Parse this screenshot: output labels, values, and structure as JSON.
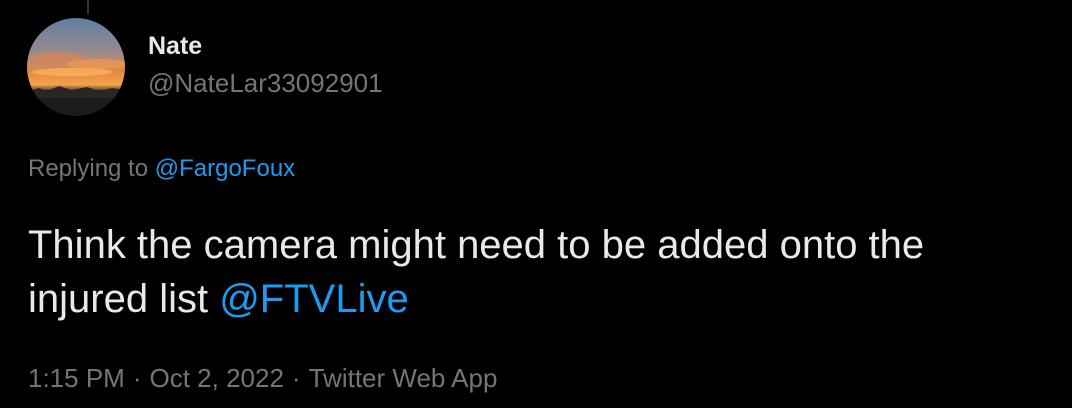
{
  "tweet": {
    "author": {
      "display_name": "Nate",
      "handle": "@NateLar33092901"
    },
    "replying_prefix": "Replying to",
    "replying_to": "@FargoFoux",
    "text_line1": "Think the camera might need to be added onto the",
    "text_line2_prefix": "injured list",
    "text_mention": "@FTVLive",
    "time": "1:15 PM",
    "date": "Oct 2, 2022",
    "source": "Twitter Web App",
    "separator": "·"
  },
  "colors": {
    "background": "#000000",
    "text_primary": "#e7e9ea",
    "text_secondary": "#71767b",
    "link": "#1d9bf0"
  },
  "icons": {
    "avatar": "avatar-sunset-photo"
  }
}
